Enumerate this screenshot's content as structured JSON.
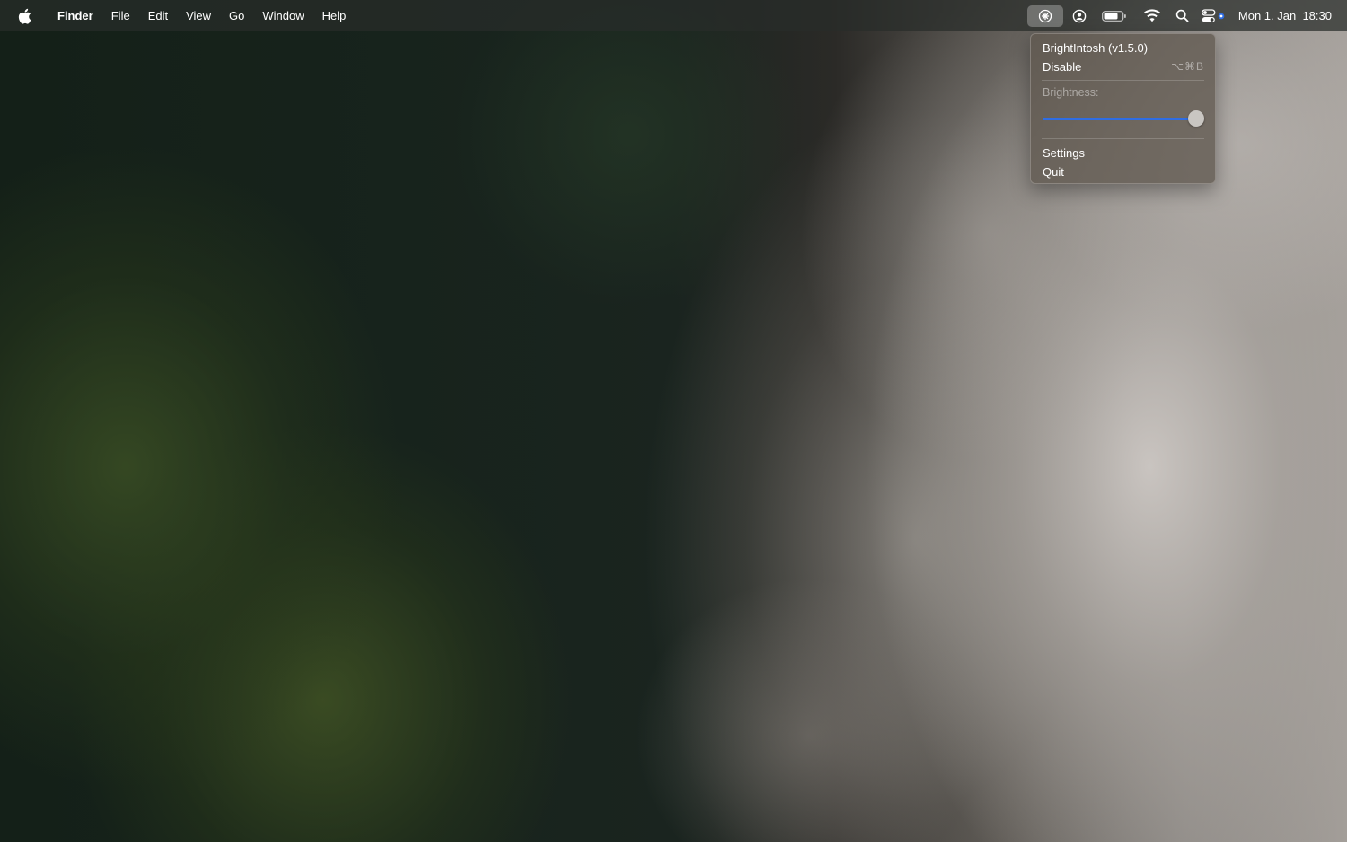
{
  "menubar": {
    "app_name": "Finder",
    "menus": [
      "File",
      "Edit",
      "View",
      "Go",
      "Window",
      "Help"
    ],
    "status_icons": [
      "brightintosh-icon",
      "user-icon",
      "battery-icon",
      "wifi-icon",
      "search-icon",
      "control-center-icon"
    ],
    "clock": {
      "date": "Mon 1. Jan",
      "time": "18:30"
    }
  },
  "dropdown": {
    "title": "BrightIntosh (v1.5.0)",
    "disable_label": "Disable",
    "disable_shortcut": "⌥⌘B",
    "brightness_label": "Brightness:",
    "brightness_value": 0.95,
    "settings_label": "Settings",
    "quit_label": "Quit"
  },
  "colors": {
    "slider_fill": "#2f6de3",
    "menu_bg": "#605850"
  }
}
